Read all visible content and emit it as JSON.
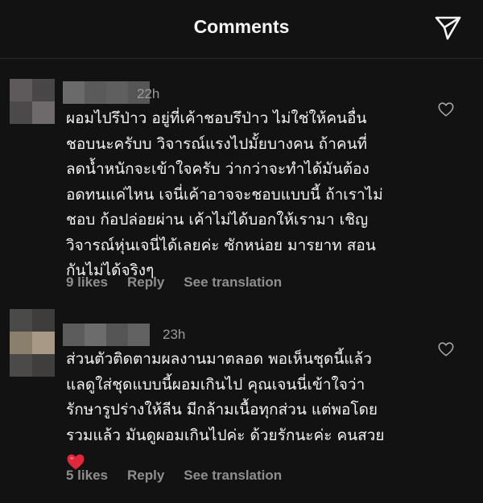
{
  "header": {
    "title": "Comments"
  },
  "comments": [
    {
      "timestamp": "22h",
      "lines": [
        "ผอมไปรึป่าว อยู่ที่เค้าชอบรึป่าว ไม่ใช่ให้คนอื่น",
        "ชอบนะครับบ  วิจารณ์แรงไปมั้ยบางคน  ถ้าคนที่",
        "ลดน้ำหนักจะเข้าใจครับ ว่ากว่าจะทำได้มันต้อง",
        "อดทนแค่ไหน เจนี่เค้าอาจจะชอบแบบนี้ ถ้าเราไม่",
        "ชอบ ก้อปล่อยผ่าน เค้าไม่ได้บอกให้เรามา เชิญ",
        "วิจารณ์หุ่นเจนี่ได้เลยค่ะ ซักหน่อย  มารยาท สอน",
        "กันไม่ได้จริงๆ"
      ],
      "likes": "9 likes",
      "reply": "Reply",
      "translate": "See translation"
    },
    {
      "timestamp": "23h",
      "lines": [
        "ส่วนตัวติดตามผลงานมาตลอด พอเห็นชุดนี้แล้ว",
        "แลดูใส่ชุดแบบนี้ผอมเกินไป คุณเจนนี่เข้าใจว่า",
        "รักษารูปร่างให้ลีน มีกล้ามเนื้อทุกส่วน แต่พอโดย",
        "รวมแล้ว มันดูผอมเกินไปค่ะ ด้วยรักนะค่ะ คนสวย"
      ],
      "emoji": "red-heart",
      "likes": "5 likes",
      "reply": "Reply",
      "translate": "See translation"
    }
  ],
  "colors": {
    "background": "#121212",
    "text": "#f2f2f2",
    "muted": "#8e8e8e",
    "heart": "#e0283d"
  }
}
